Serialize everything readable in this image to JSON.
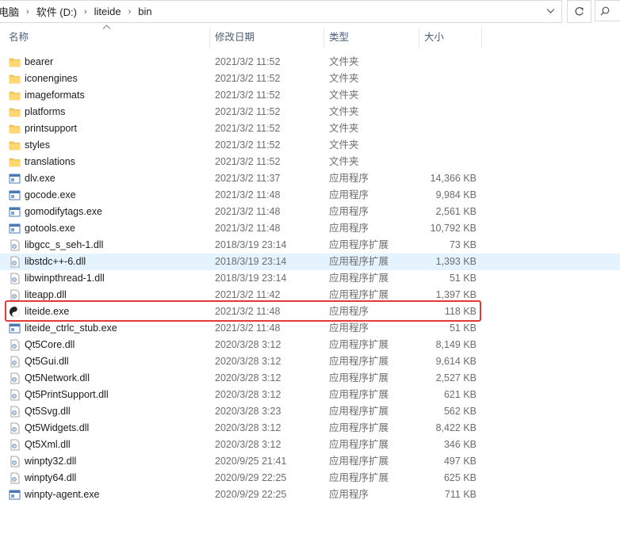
{
  "address": {
    "breadcrumbs": [
      "电脑",
      "软件 (D:)",
      "liteide",
      "bin"
    ]
  },
  "columns": {
    "name": "名称",
    "date": "修改日期",
    "type": "类型",
    "size": "大小"
  },
  "rows": [
    {
      "name": "bearer",
      "date": "2021/3/2 11:52",
      "type": "文件夹",
      "size": "",
      "icon": "folder-icon"
    },
    {
      "name": "iconengines",
      "date": "2021/3/2 11:52",
      "type": "文件夹",
      "size": "",
      "icon": "folder-icon"
    },
    {
      "name": "imageformats",
      "date": "2021/3/2 11:52",
      "type": "文件夹",
      "size": "",
      "icon": "folder-icon"
    },
    {
      "name": "platforms",
      "date": "2021/3/2 11:52",
      "type": "文件夹",
      "size": "",
      "icon": "folder-icon"
    },
    {
      "name": "printsupport",
      "date": "2021/3/2 11:52",
      "type": "文件夹",
      "size": "",
      "icon": "folder-icon"
    },
    {
      "name": "styles",
      "date": "2021/3/2 11:52",
      "type": "文件夹",
      "size": "",
      "icon": "folder-icon"
    },
    {
      "name": "translations",
      "date": "2021/3/2 11:52",
      "type": "文件夹",
      "size": "",
      "icon": "folder-icon"
    },
    {
      "name": "dlv.exe",
      "date": "2021/3/2 11:37",
      "type": "应用程序",
      "size": "14,366 KB",
      "icon": "exe-icon"
    },
    {
      "name": "gocode.exe",
      "date": "2021/3/2 11:48",
      "type": "应用程序",
      "size": "9,984 KB",
      "icon": "exe-icon"
    },
    {
      "name": "gomodifytags.exe",
      "date": "2021/3/2 11:48",
      "type": "应用程序",
      "size": "2,561 KB",
      "icon": "exe-icon"
    },
    {
      "name": "gotools.exe",
      "date": "2021/3/2 11:48",
      "type": "应用程序",
      "size": "10,792 KB",
      "icon": "exe-icon"
    },
    {
      "name": "libgcc_s_seh-1.dll",
      "date": "2018/3/19 23:14",
      "type": "应用程序扩展",
      "size": "73 KB",
      "icon": "dll-icon"
    },
    {
      "name": "libstdc++-6.dll",
      "date": "2018/3/19 23:14",
      "type": "应用程序扩展",
      "size": "1,393 KB",
      "icon": "dll-icon"
    },
    {
      "name": "libwinpthread-1.dll",
      "date": "2018/3/19 23:14",
      "type": "应用程序扩展",
      "size": "51 KB",
      "icon": "dll-icon"
    },
    {
      "name": "liteapp.dll",
      "date": "2021/3/2 11:42",
      "type": "应用程序扩展",
      "size": "1,397 KB",
      "icon": "dll-icon"
    },
    {
      "name": "liteide.exe",
      "date": "2021/3/2 11:48",
      "type": "应用程序",
      "size": "118 KB",
      "icon": "liteide-app-icon"
    },
    {
      "name": "liteide_ctrlc_stub.exe",
      "date": "2021/3/2 11:48",
      "type": "应用程序",
      "size": "51 KB",
      "icon": "exe-icon"
    },
    {
      "name": "Qt5Core.dll",
      "date": "2020/3/28 3:12",
      "type": "应用程序扩展",
      "size": "8,149 KB",
      "icon": "dll-icon"
    },
    {
      "name": "Qt5Gui.dll",
      "date": "2020/3/28 3:12",
      "type": "应用程序扩展",
      "size": "9,614 KB",
      "icon": "dll-icon"
    },
    {
      "name": "Qt5Network.dll",
      "date": "2020/3/28 3:12",
      "type": "应用程序扩展",
      "size": "2,527 KB",
      "icon": "dll-icon"
    },
    {
      "name": "Qt5PrintSupport.dll",
      "date": "2020/3/28 3:12",
      "type": "应用程序扩展",
      "size": "621 KB",
      "icon": "dll-icon"
    },
    {
      "name": "Qt5Svg.dll",
      "date": "2020/3/28 3:23",
      "type": "应用程序扩展",
      "size": "562 KB",
      "icon": "dll-icon"
    },
    {
      "name": "Qt5Widgets.dll",
      "date": "2020/3/28 3:12",
      "type": "应用程序扩展",
      "size": "8,422 KB",
      "icon": "dll-icon"
    },
    {
      "name": "Qt5Xml.dll",
      "date": "2020/3/28 3:12",
      "type": "应用程序扩展",
      "size": "346 KB",
      "icon": "dll-icon"
    },
    {
      "name": "winpty32.dll",
      "date": "2020/9/25 21:41",
      "type": "应用程序扩展",
      "size": "497 KB",
      "icon": "dll-icon"
    },
    {
      "name": "winpty64.dll",
      "date": "2020/9/29 22:25",
      "type": "应用程序扩展",
      "size": "625 KB",
      "icon": "dll-icon"
    },
    {
      "name": "winpty-agent.exe",
      "date": "2020/9/29 22:25",
      "type": "应用程序",
      "size": "711 KB",
      "icon": "exe-icon"
    }
  ],
  "hover_row": 12,
  "highlighted_row": 15,
  "colors": {
    "folder": "#f7c85a",
    "hover_bg": "#e5f3ff",
    "highlight_border": "#e53b36",
    "header_text": "#4c607a"
  }
}
